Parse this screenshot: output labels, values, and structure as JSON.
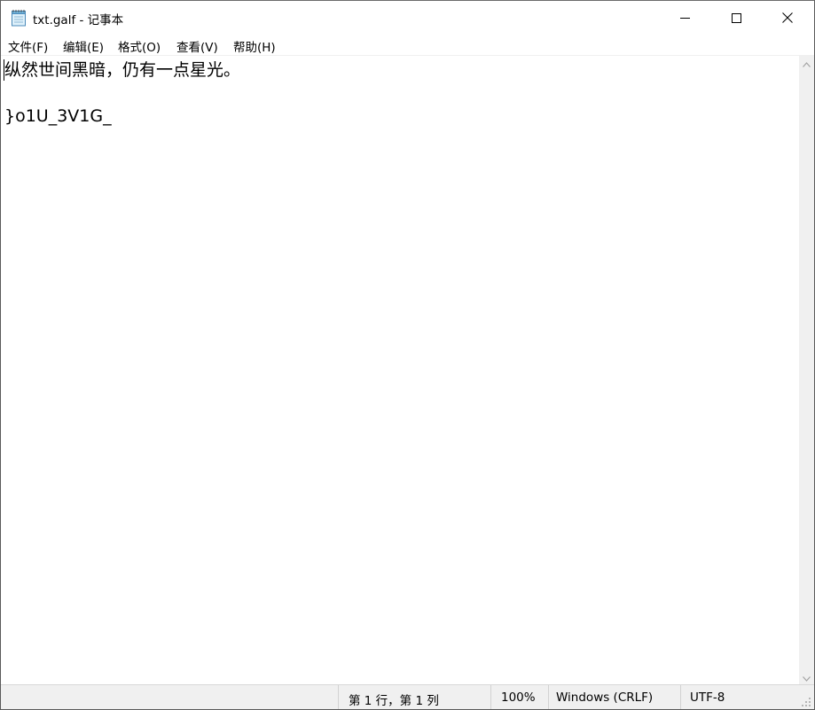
{
  "window": {
    "title": "txt.galf - 记事本",
    "icon": "notepad-icon"
  },
  "titlebar_controls": {
    "minimize_icon": "minimize-icon",
    "maximize_icon": "maximize-icon",
    "close_icon": "close-icon"
  },
  "menu": {
    "items": [
      {
        "label": "文件(F)"
      },
      {
        "label": "编辑(E)"
      },
      {
        "label": "格式(O)"
      },
      {
        "label": "查看(V)"
      },
      {
        "label": "帮助(H)"
      }
    ]
  },
  "editor": {
    "lines": [
      "纵然世间黑暗，仍有一点星光。",
      "",
      "}o1U_3V1G_"
    ]
  },
  "statusbar": {
    "position": "第 1 行，第 1 列",
    "zoom": "100%",
    "line_ending": "Windows (CRLF)",
    "encoding": "UTF-8"
  },
  "colors": {
    "window_bg": "#ffffff",
    "statusbar_bg": "#f0f0f0",
    "text": "#000000"
  }
}
